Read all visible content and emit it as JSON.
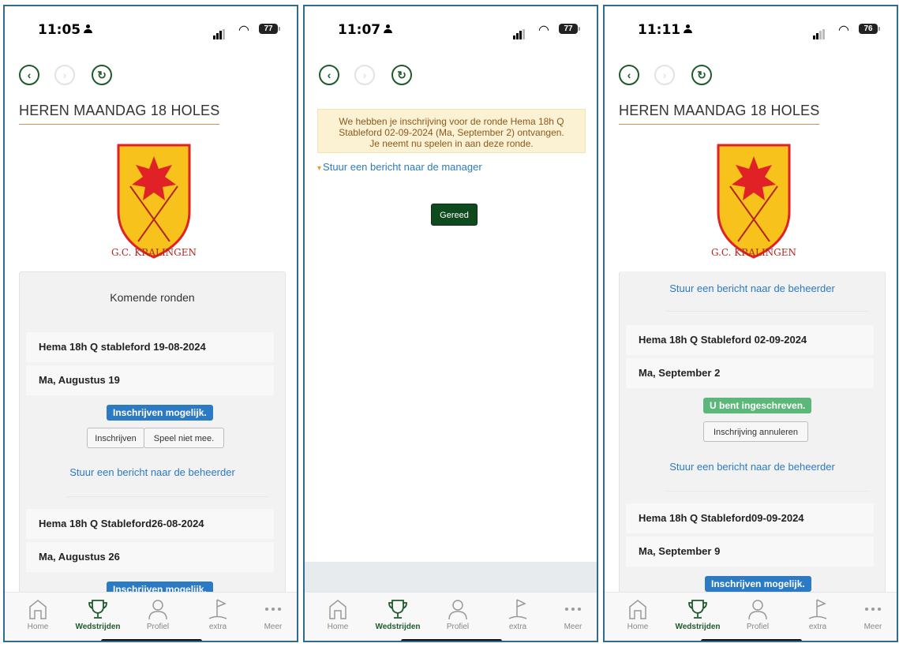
{
  "tabs": {
    "home": "Home",
    "wedstrijden": "Wedstrijden",
    "profiel": "Profiel",
    "extra": "extra",
    "meer": "Meer"
  },
  "screens": [
    {
      "time": "11:05",
      "battery": "77",
      "heading": "HEREN MAANDAG 18 HOLES",
      "logo_text": "G.C. KRALINGEN",
      "card_title": "Komende ronden",
      "round1_name": "Hema 18h Q stableford 19-08-2024",
      "round1_date": "Ma, Augustus 19",
      "badge": "Inschrijven mogelijk.",
      "btn_register": "Inschrijven",
      "btn_decline": "Speel niet mee.",
      "link": "Stuur een bericht naar de beheerder",
      "round2_name": "Hema 18h Q Stableford26-08-2024",
      "round2_date": "Ma, Augustus 26",
      "badge2": "Inschrijven mogelijk."
    },
    {
      "time": "11:07",
      "battery": "77",
      "alert_line1": "We hebben je inschrijving voor de ronde Hema 18h Q",
      "alert_line2": "Stableford 02-09-2024 (Ma, September 2) ontvangen.",
      "alert_line3": "Je neemt nu spelen in aan deze ronde.",
      "manager_link": "Stuur een bericht naar de manager",
      "done_button": "Gereed"
    },
    {
      "time": "11:11",
      "battery": "76",
      "heading": "HEREN MAANDAG 18 HOLES",
      "logo_text": "G.C. KRALINGEN",
      "link_top": "Stuur een bericht naar de beheerder",
      "round1_name": "Hema 18h Q Stableford 02-09-2024",
      "round1_date": "Ma, September 2",
      "badge_registered": "U bent ingeschreven.",
      "btn_cancel": "Inschrijving annuleren",
      "link": "Stuur een bericht naar de beheerder",
      "round2_name": "Hema 18h Q Stableford09-09-2024",
      "round2_date": "Ma, September 9",
      "badge2": "Inschrijven mogelijk."
    }
  ],
  "colors": {
    "brand_green": "#1e5b2a",
    "link_blue": "#2c7ac3",
    "badge_blue": "#2c7ac3",
    "badge_green": "#5cb87a",
    "alert_bg": "#fbf1d3",
    "heading_underline": "#d98a52",
    "logo_yellow": "#f6c21b",
    "logo_red": "#e02226"
  }
}
